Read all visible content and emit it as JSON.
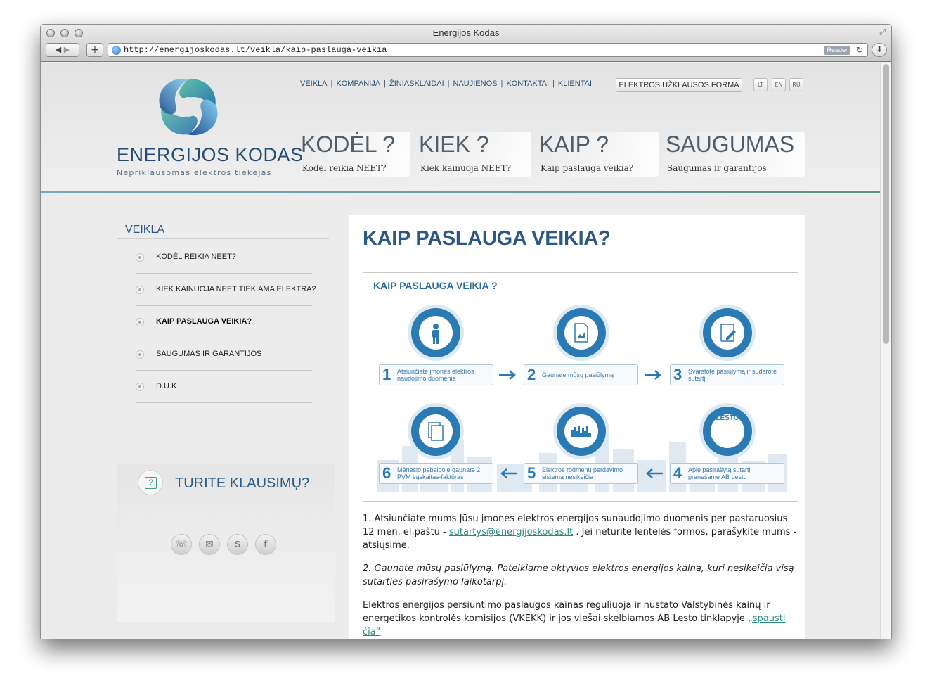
{
  "browser": {
    "title": "Energijos Kodas",
    "url": "http://energijoskodas.lt/veikla/kaip-paslauga-veikia",
    "reader_label": "Reader"
  },
  "brand": {
    "name": "ENERGIJOS KODAS",
    "tagline": "Nepriklausomas elektros tiekėjas"
  },
  "topnav": [
    "VEIKLA",
    "KOMPANIJA",
    "ŽINIASKLAIDAI",
    "NAUJIENOS",
    "KONTAKTAI",
    "KLIENTAI"
  ],
  "form_button": "ELEKTROS UŽKLAUSOS FORMA",
  "languages": [
    "LT",
    "EN",
    "RU"
  ],
  "main_tabs": [
    {
      "title": "KODĖL ?",
      "subtitle": "Kodėl reikia NEET?"
    },
    {
      "title": "KIEK ?",
      "subtitle": "Kiek kainuoja NEET?"
    },
    {
      "title": "KAIP ?",
      "subtitle": "Kaip paslauga veikia?"
    },
    {
      "title": "SAUGUMAS",
      "subtitle": "Saugumas ir garantijos"
    }
  ],
  "sidebar": {
    "heading": "VEIKLA",
    "items": [
      {
        "label": "KODĖL REIKIA NEET?",
        "active": false
      },
      {
        "label": "KIEK KAINUOJA NEET TIEKIAMA ELEKTRA?",
        "active": false
      },
      {
        "label": "KAIP PASLAUGA VEIKIA?",
        "active": true
      },
      {
        "label": "SAUGUMAS IR GARANTIJOS",
        "active": false
      },
      {
        "label": "D.U.K",
        "active": false
      }
    ]
  },
  "questions": {
    "icon_text": "?",
    "title": "TURITE KLAUSIMŲ?",
    "social_icons": [
      "phone-icon",
      "mail-icon",
      "skype-icon",
      "facebook-icon"
    ]
  },
  "content": {
    "title": "KAIP PASLAUGA VEIKIA?",
    "diagram": {
      "title": "KAIP PASLAUGA VEIKIA ?",
      "lesto_label": "LESTO",
      "steps": [
        {
          "num": "1",
          "text": "Atsiunčiate įmonės elektros naudojimo duomenis",
          "icon": "person-icon"
        },
        {
          "num": "2",
          "text": "Gaunate mūsų pasiūlymą",
          "icon": "chart-document-icon"
        },
        {
          "num": "3",
          "text": "Svarstote pasiūlymą ir sudarote sutartį",
          "icon": "pencil-document-icon"
        },
        {
          "num": "4",
          "text": "Apie pasirašytą sutartį pranešame AB Lesto",
          "icon": "lesto-logo-icon"
        },
        {
          "num": "5",
          "text": "Elektros rodmenų perdavimo sistema nesikeičia",
          "icon": "city-icon"
        },
        {
          "num": "6",
          "text": "Mėnesio pabaigoje gaunate 2 PVM sąskaitas-faktūras",
          "icon": "documents-icon"
        }
      ]
    },
    "p1_text": "1. Atsiunčiate mums Jūsų įmonės elektros energijos sunaudojimo duomenis per pastaruosius 12 mėn. el.paštu - ",
    "p1_link": "sutartys@energijoskodas.lt",
    "p1_after": " . Jei neturite lentelės formos, parašykite mums - atsiųsime.",
    "p2_text": "2. Gaunate mūsų pasiūlymą. Pateikiame aktyvios elektros energijos kainą, kuri nesikeičia visą sutarties pasirašymo laikotarpį.",
    "p3_text": "Elektros energijos persiuntimo paslaugos kainas reguliuoja ir nustato Valstybinės kainų ir energetikos kontrolės komisijos (VKEKK) ir jos viešai skelbiamos AB Lesto tinklapyje ",
    "p3_link": "„spausti čia“"
  },
  "colors": {
    "brand_blue": "#2b5884",
    "step_blue": "#2b7ab3",
    "link_teal": "#2a8a79"
  }
}
